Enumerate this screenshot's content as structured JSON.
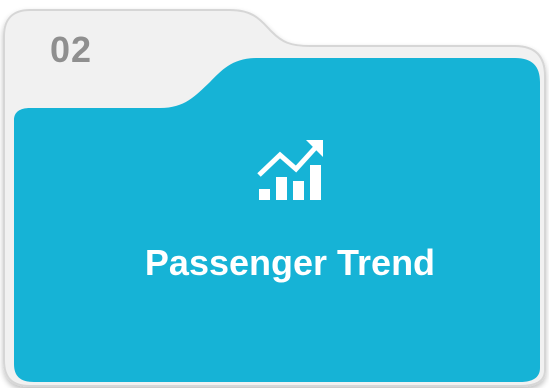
{
  "card": {
    "section_number": "02",
    "title": "Passenger Trend",
    "icon": "trend-chart-icon",
    "colors": {
      "tab_fill": "#f1f1f1",
      "tab_stroke": "#d6d6d6",
      "front_fill": "#16b3d6",
      "number_text": "#8f8f8f",
      "title_text": "#ffffff"
    }
  }
}
